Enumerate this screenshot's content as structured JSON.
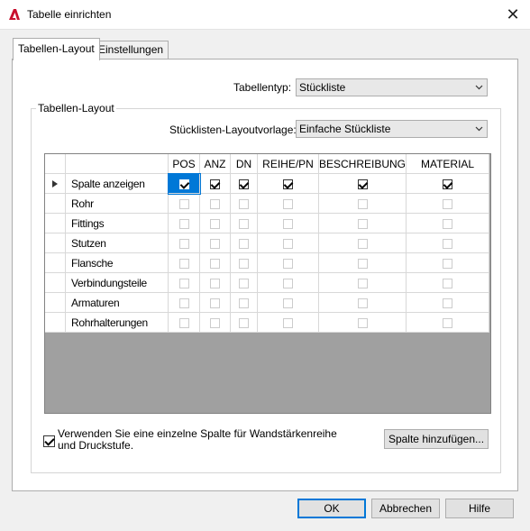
{
  "window": {
    "title": "Tabelle einrichten",
    "close_glyph": "✕"
  },
  "tabs": [
    {
      "label": "Tabellen-Layout",
      "active": true
    },
    {
      "label": "Einstellungen",
      "active": false
    }
  ],
  "table_type": {
    "label": "Tabellentyp:",
    "value": "Stückliste"
  },
  "layout_group": {
    "legend": "Tabellen-Layout",
    "template_label": "Stücklisten-Layoutvorlage:",
    "template_value": "Einfache Stückliste",
    "columns": [
      "POS",
      "ANZ",
      "DN",
      "REIHE/PN",
      "BESCHREIBUNG",
      "MATERIAL"
    ],
    "rows": [
      {
        "label": "Spalte anzeigen",
        "current": true,
        "enabled": true,
        "checked": [
          true,
          true,
          true,
          true,
          true,
          true
        ]
      },
      {
        "label": "Rohr",
        "current": false,
        "enabled": false,
        "checked": [
          false,
          false,
          false,
          false,
          false,
          false
        ]
      },
      {
        "label": "Fittings",
        "current": false,
        "enabled": false,
        "checked": [
          false,
          false,
          false,
          false,
          false,
          false
        ]
      },
      {
        "label": "Stutzen",
        "current": false,
        "enabled": false,
        "checked": [
          false,
          false,
          false,
          false,
          false,
          false
        ]
      },
      {
        "label": "Flansche",
        "current": false,
        "enabled": false,
        "checked": [
          false,
          false,
          false,
          false,
          false,
          false
        ]
      },
      {
        "label": "Verbindungsteile",
        "current": false,
        "enabled": false,
        "checked": [
          false,
          false,
          false,
          false,
          false,
          false
        ]
      },
      {
        "label": "Armaturen",
        "current": false,
        "enabled": false,
        "checked": [
          false,
          false,
          false,
          false,
          false,
          false
        ]
      },
      {
        "label": "Rohrhalterungen",
        "current": false,
        "enabled": false,
        "checked": [
          false,
          false,
          false,
          false,
          false,
          false
        ]
      }
    ],
    "single_column_option": {
      "label": "Verwenden Sie eine einzelne Spalte für Wandstärkenreihe und Druckstufe.",
      "checked": true
    },
    "add_column_button": "Spalte hinzufügen..."
  },
  "buttons": {
    "ok": "OK",
    "cancel": "Abbrechen",
    "help": "Hilfe"
  }
}
